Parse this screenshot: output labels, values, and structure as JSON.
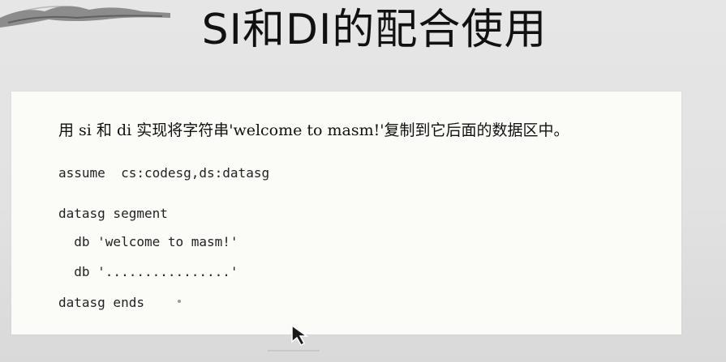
{
  "slide": {
    "title": "SI和DI的配合使用"
  },
  "card": {
    "prompt": "用 si 和 di 实现将字符串'welcome to masm!'复制到它后面的数据区中。",
    "code_lines": [
      "assume  cs:codesg,ds:datasg",
      "datasg segment",
      "  db 'welcome to masm!'",
      "  db '................'",
      "datasg ends"
    ]
  },
  "colors": {
    "page_background": "#e3e3e3",
    "card_background": "#fbfbf7",
    "text": "#111111"
  },
  "icons": [
    "ink-mountain-decoration",
    "mouse-cursor-icon"
  ]
}
